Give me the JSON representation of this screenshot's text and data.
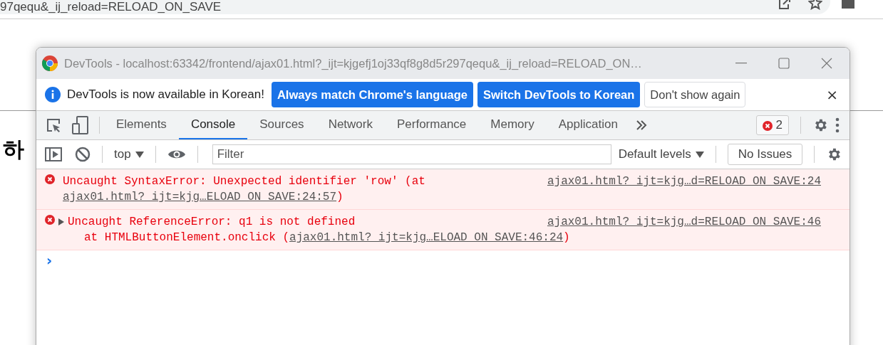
{
  "browser": {
    "address_text": "97qequ&_ij_reload=RELOAD_ON_SAVE",
    "heading": "하"
  },
  "devtools": {
    "title": "DevTools - localhost:63342/frontend/ajax01.html?_ijt=kjgefj1oj33qf8g8d5r297qequ&_ij_reload=RELOAD_ON…",
    "infobar": {
      "message": "DevTools is now available in Korean!",
      "buttons": [
        {
          "label": "Always match Chrome's language",
          "kind": "primary"
        },
        {
          "label": "Switch DevTools to Korean",
          "kind": "primary"
        },
        {
          "label": "Don't show again",
          "kind": "secondary"
        }
      ],
      "close": "×"
    },
    "tabs": [
      {
        "label": "Elements",
        "selected": false
      },
      {
        "label": "Console",
        "selected": true
      },
      {
        "label": "Sources",
        "selected": false
      },
      {
        "label": "Network",
        "selected": false
      },
      {
        "label": "Performance",
        "selected": false
      },
      {
        "label": "Memory",
        "selected": false
      },
      {
        "label": "Application",
        "selected": false
      }
    ],
    "error_count": "2",
    "console_toolbar": {
      "context": "top",
      "filter_placeholder": "Filter",
      "levels": "Default levels",
      "issues": "No Issues"
    },
    "messages": [
      {
        "text": "Uncaught SyntaxError: Unexpected identifier 'row' (at ",
        "link": "ajax01.html?_ijt=kjg…ELOAD_ON_SAVE:24:57",
        "suffix": ")",
        "source": "ajax01.html?_ijt=kjg…d=RELOAD_ON_SAVE:24"
      },
      {
        "text": "Uncaught ReferenceError: q1 is not defined",
        "expanded": false,
        "detail": "at HTMLButtonElement.onclick (",
        "link": "ajax01.html?_ijt=kjg…ELOAD_ON_SAVE:46:24",
        "suffix": ")",
        "source": "ajax01.html?_ijt=kjg…d=RELOAD_ON_SAVE:46"
      }
    ],
    "prompt": "›"
  }
}
